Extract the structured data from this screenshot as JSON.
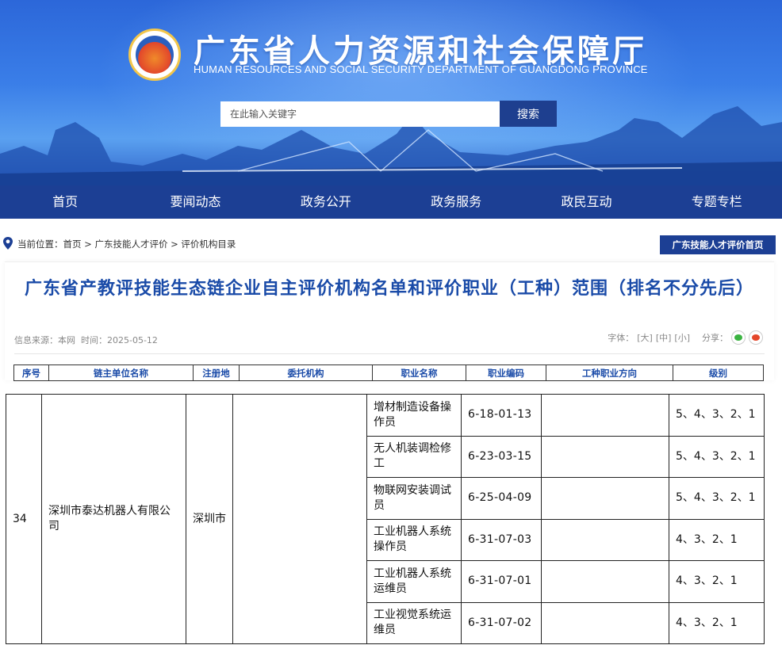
{
  "header": {
    "site_title": "广东省人力资源和社会保障厅",
    "site_subtitle": "HUMAN RESOURCES AND SOCIAL SECURITY DEPARTMENT OF GUANGDONG PROVINCE",
    "search_placeholder": "在此输入关键字",
    "search_button": "搜索"
  },
  "nav": {
    "items": [
      "首页",
      "要闻动态",
      "政务公开",
      "政务服务",
      "政民互动",
      "专题专栏"
    ]
  },
  "breadcrumb": {
    "label": "当前位置：",
    "items": [
      "首页",
      "广东技能人才评价",
      "评价机构目录"
    ],
    "separator": " > ",
    "home_button": "广东技能人才评价首页"
  },
  "article": {
    "title": "广东省产教评技能生态链企业自主评价机构名单和评价职业（工种）范围（排名不分先后）",
    "source_label": "信息来源：",
    "source_value": "本网",
    "time_label": "时间：",
    "time_value": "2025-05-12",
    "font_label": "字体：",
    "font_sizes": [
      "[大]",
      "[中]",
      "[小]"
    ],
    "share_label": "分享："
  },
  "table": {
    "headers": [
      "序号",
      "链主单位名称",
      "注册地",
      "委托机构",
      "职业名称",
      "职业编码",
      "工种职业方向",
      "级别"
    ],
    "group": {
      "index": "34",
      "company": "深圳市泰达机器人有限公司",
      "location": "深圳市",
      "agency": "",
      "rows": [
        {
          "occupation": "增材制造设备操作员",
          "code": "6-18-01-13",
          "direction": "",
          "level": "5、4、3、2、1"
        },
        {
          "occupation": "无人机装调检修工",
          "code": "6-23-03-15",
          "direction": "",
          "level": "5、4、3、2、1"
        },
        {
          "occupation": "物联网安装调试员",
          "code": "6-25-04-09",
          "direction": "",
          "level": "5、4、3、2、1"
        },
        {
          "occupation": "工业机器人系统操作员",
          "code": "6-31-07-03",
          "direction": "",
          "level": "4、3、2、1"
        },
        {
          "occupation": "工业机器人系统运维员",
          "code": "6-31-07-01",
          "direction": "",
          "level": "4、3、2、1"
        },
        {
          "occupation": "工业视觉系统运维员",
          "code": "6-31-07-02",
          "direction": "",
          "level": "4、3、2、1"
        }
      ]
    }
  },
  "colors": {
    "nav_bg": "#1c3f94",
    "title_blue": "#1a4ba8",
    "search_btn": "#1e3f8f"
  }
}
